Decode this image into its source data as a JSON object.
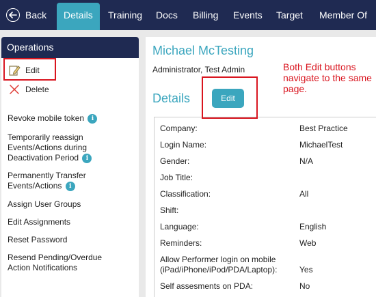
{
  "nav": {
    "back_label": "Back",
    "tabs": [
      "Details",
      "Training",
      "Docs",
      "Billing",
      "Events",
      "Target",
      "Member Of"
    ]
  },
  "operations": {
    "title": "Operations",
    "edit_label": "Edit",
    "delete_label": "Delete",
    "items": [
      "Revoke mobile token",
      "Temporarily reassign Events/Actions during Deactivation Period",
      "Permanently Transfer Events/Actions",
      "Assign User Groups",
      "Edit Assignments",
      "Reset Password",
      "Resend Pending/Overdue Action Notifications"
    ]
  },
  "profile": {
    "name": "Michael McTesting",
    "role": "Administrator, Test Admin",
    "section_title": "Details",
    "edit_button": "Edit",
    "fields": [
      {
        "label": "Company:",
        "value": "Best Practice"
      },
      {
        "label": "Login Name:",
        "value": "MichaelTest"
      },
      {
        "label": "Gender:",
        "value": "N/A"
      },
      {
        "label": "Job Title:",
        "value": ""
      },
      {
        "label": "Classification:",
        "value": "All"
      },
      {
        "label": "Shift:",
        "value": ""
      },
      {
        "label": "Language:",
        "value": "English"
      },
      {
        "label": "Reminders:",
        "value": "Web"
      },
      {
        "label": "Allow Performer login on mobile (iPad/iPhone/iPod/PDA/Laptop):",
        "value": "Yes"
      },
      {
        "label": "Self assesments on PDA:",
        "value": "No"
      }
    ]
  },
  "annotation": {
    "note": "Both Edit buttons navigate to the same page."
  },
  "colors": {
    "nav_bg": "#1f2a52",
    "accent": "#3ba6be",
    "annotation_red": "#d9141e"
  }
}
